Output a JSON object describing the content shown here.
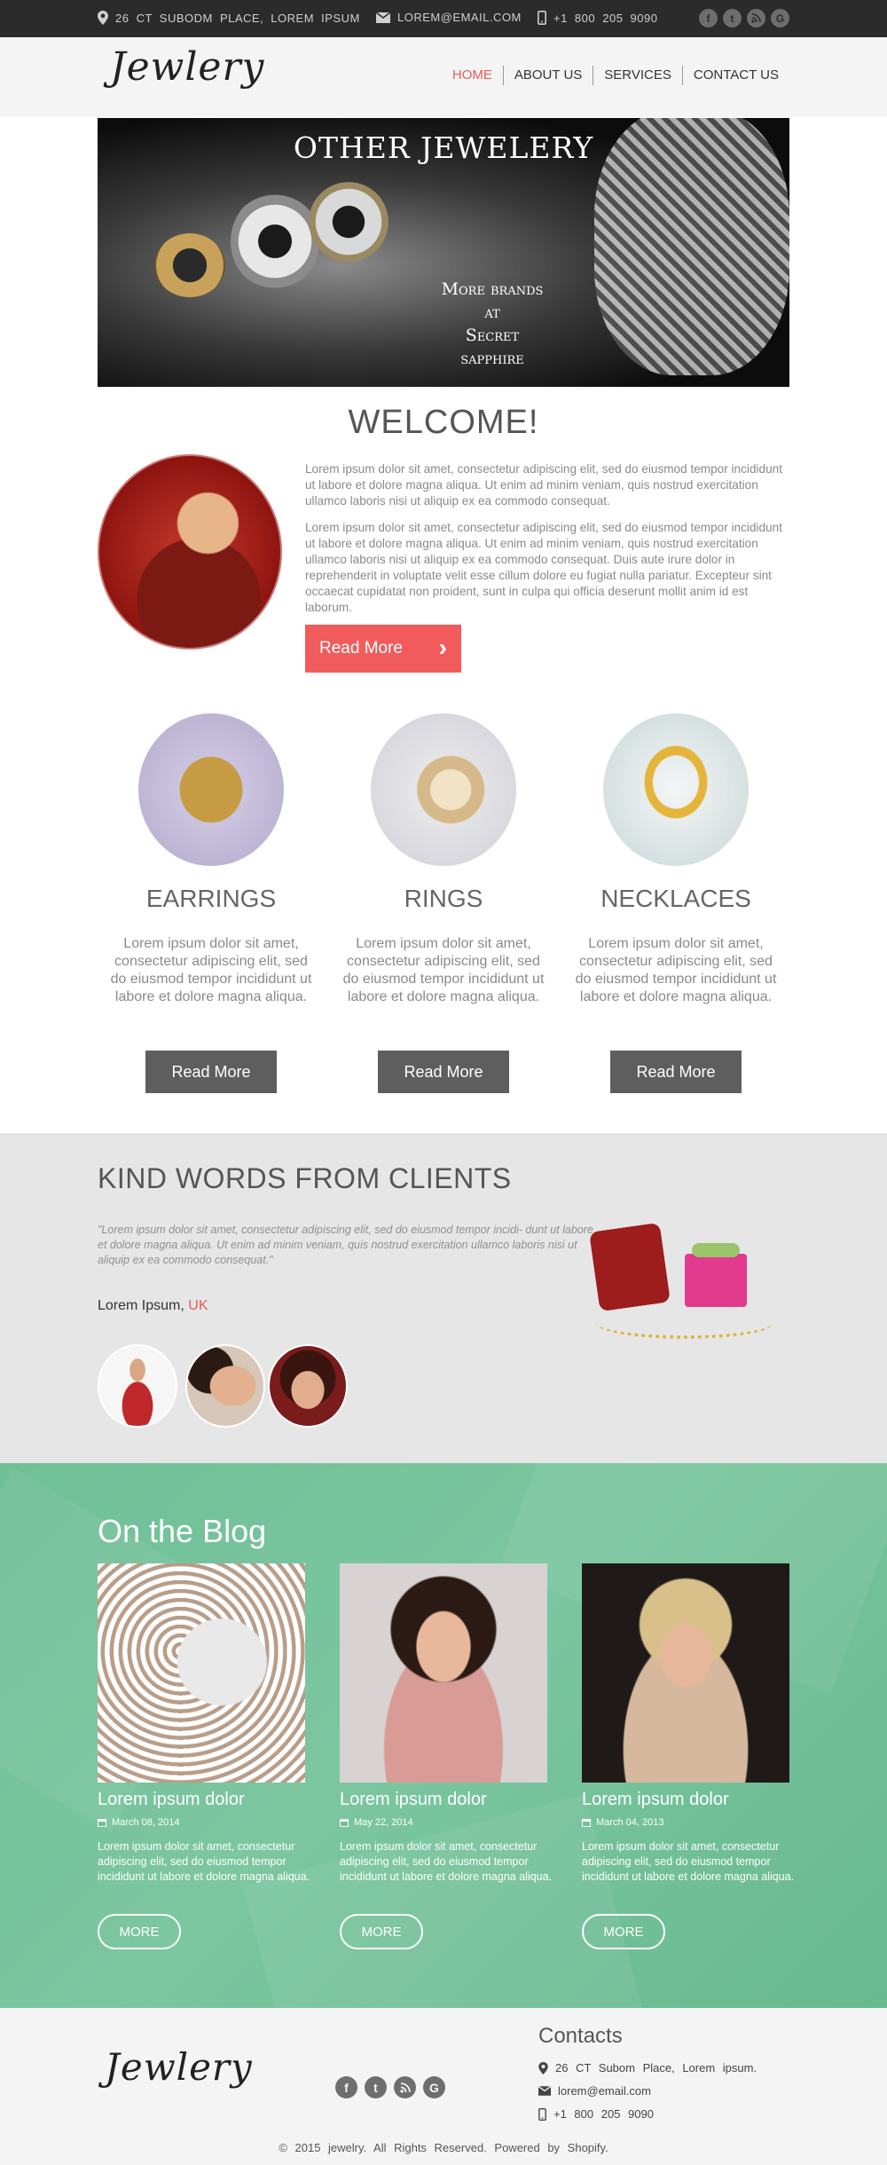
{
  "topbar": {
    "address": "26 CT SUBODM PLACE, LOREM IPSUM",
    "email": "LOREM@EMAIL.COM",
    "phone": "+1 800 205 9090",
    "socials": [
      "f",
      "t",
      "rss",
      "G"
    ]
  },
  "header": {
    "logo": "Jewlery",
    "nav": [
      "HOME",
      "ABOUT US",
      "SERVICES",
      "CONTACT US"
    ]
  },
  "banner": {
    "title": "OTHER JEWELERY",
    "subtitle_lines": [
      "More brands",
      "at",
      "Secret",
      "sapphire"
    ]
  },
  "welcome": {
    "title": "WELCOME!",
    "para1": "Lorem ipsum dolor sit amet, consectetur adipiscing elit, sed do eiusmod tempor incididunt ut labore et dolore magna aliqua. Ut enim ad minim veniam, quis nostrud exercitation ullamco laboris nisi ut aliquip ex ea commodo consequat.",
    "para2": "Lorem ipsum dolor sit amet, consectetur adipiscing elit, sed do eiusmod tempor incididunt ut labore et dolore magna aliqua. Ut enim ad minim veniam, quis nostrud exercitation ullamco laboris nisi ut aliquip ex ea commodo consequat. Duis aute irure dolor in reprehenderit in voluptate velit esse cillum dolore eu fugiat nulla pariatur. Excepteur sint occaecat cupidatat non proident, sunt in culpa qui officia deserunt mollit anim id est laborum.",
    "button": "Read More"
  },
  "products": [
    {
      "title": "EARRINGS",
      "text": "Lorem ipsum dolor sit amet, consectetur adipiscing elit, sed do eiusmod tempor incididunt ut labore et dolore magna aliqua.",
      "button": "Read More"
    },
    {
      "title": "RINGS",
      "text": "Lorem ipsum dolor sit amet, consectetur adipiscing elit, sed do eiusmod tempor incididunt ut labore et dolore magna aliqua.",
      "button": "Read More"
    },
    {
      "title": "NECKLACES",
      "text": "Lorem ipsum dolor sit amet, consectetur adipiscing elit, sed do eiusmod tempor incididunt ut labore et dolore magna aliqua.",
      "button": "Read More"
    }
  ],
  "testimonials": {
    "title": "KIND WORDS FROM CLIENTS",
    "quote": "\"Lorem ipsum dolor sit amet, consectetur adipiscing elit, sed do eiusmod tempor incidi- dunt ut labore et dolore magna aliqua. Ut enim ad minim veniam, quis nostrud exercitation ullamco laboris nisi ut aliquip ex ea commodo consequat.\"",
    "author": "Lorem Ipsum,",
    "place": "UK"
  },
  "blog": {
    "title": "On the Blog",
    "posts": [
      {
        "title": "Lorem ipsum dolor",
        "date": "March 08, 2014",
        "text": "Lorem ipsum dolor sit amet, consectetur adipiscing elit, sed do eiusmod tempor incididunt ut labore et dolore magna aliqua.",
        "button": "MORE"
      },
      {
        "title": "Lorem ipsum dolor",
        "date": "May 22, 2014",
        "text": "Lorem ipsum dolor sit amet, consectetur adipiscing elit, sed do eiusmod tempor incididunt ut labore et dolore magna aliqua.",
        "button": "MORE"
      },
      {
        "title": "Lorem ipsum dolor",
        "date": "March 04, 2013",
        "text": "Lorem ipsum dolor sit amet, consectetur adipiscing elit, sed do eiusmod tempor incididunt ut labore et dolore magna aliqua.",
        "button": "MORE"
      }
    ]
  },
  "footer": {
    "logo": "Jewlery",
    "contacts_title": "Contacts",
    "address": "26 CT Subom Place, Lorem ipsum.",
    "email": "lorem@email.com",
    "phone": "+1 800 205 9090",
    "copyright": "© 2015 jewelry. All Rights Reserved. Powered by Shopify.",
    "socials": [
      "f",
      "t",
      "rss",
      "G"
    ]
  },
  "colors": {
    "accent": "#f25b5b",
    "topbar": "#2b2b2b",
    "blog_bg": "#72c099",
    "testimonial_bg": "#e6e6e6"
  }
}
